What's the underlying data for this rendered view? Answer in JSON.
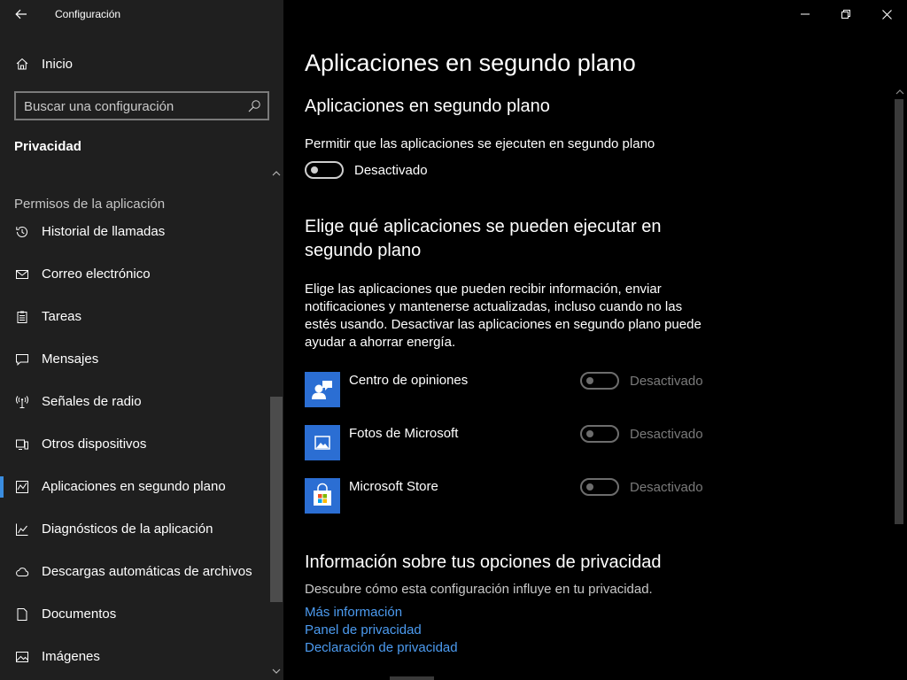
{
  "window": {
    "title": "Configuración"
  },
  "sidebar": {
    "home_label": "Inicio",
    "search_placeholder": "Buscar una configuración",
    "section_title": "Privacidad",
    "group_label": "Permisos de la aplicación",
    "items": [
      {
        "label": "Historial de llamadas",
        "icon": "history-icon"
      },
      {
        "label": "Correo electrónico",
        "icon": "mail-icon"
      },
      {
        "label": "Tareas",
        "icon": "tasks-icon"
      },
      {
        "label": "Mensajes",
        "icon": "message-icon"
      },
      {
        "label": "Señales de radio",
        "icon": "radio-icon"
      },
      {
        "label": "Otros dispositivos",
        "icon": "devices-icon"
      },
      {
        "label": "Aplicaciones en segundo plano",
        "icon": "background-apps-icon",
        "active": true
      },
      {
        "label": "Diagnósticos de la aplicación",
        "icon": "diagnostics-icon"
      },
      {
        "label": "Descargas automáticas de archivos",
        "icon": "cloud-icon"
      },
      {
        "label": "Documentos",
        "icon": "document-icon"
      },
      {
        "label": "Imágenes",
        "icon": "image-icon"
      }
    ]
  },
  "main": {
    "page_title": "Aplicaciones en segundo plano",
    "section1": {
      "title": "Aplicaciones en segundo plano",
      "description": "Permitir que las aplicaciones se ejecuten en segundo plano",
      "toggle_state": "Desactivado"
    },
    "section2": {
      "title_line1": "Elige qué aplicaciones se pueden ejecutar en",
      "title_line2": "segundo plano",
      "description": "Elige las aplicaciones que pueden recibir información, enviar notificaciones y mantenerse actualizadas, incluso cuando no las estés usando. Desactivar las aplicaciones en segundo plano puede ayudar a ahorrar energía.",
      "apps": [
        {
          "name": "Centro de opiniones",
          "state": "Desactivado",
          "icon": "feedback-hub-icon"
        },
        {
          "name": "Fotos de Microsoft",
          "state": "Desactivado",
          "icon": "photos-icon"
        },
        {
          "name": "Microsoft Store",
          "state": "Desactivado",
          "icon": "store-icon"
        }
      ]
    },
    "section3": {
      "title": "Información sobre tus opciones de privacidad",
      "description": "Descubre cómo esta configuración influye en tu privacidad.",
      "links": [
        "Más información",
        "Panel de privacidad",
        "Declaración de privacidad"
      ]
    }
  },
  "colors": {
    "sidebar_bg": "#1f1f1f",
    "main_bg": "#000000",
    "accent": "#3a8de0",
    "link": "#4c9bf0",
    "app_tile": "#2b6ed3"
  }
}
